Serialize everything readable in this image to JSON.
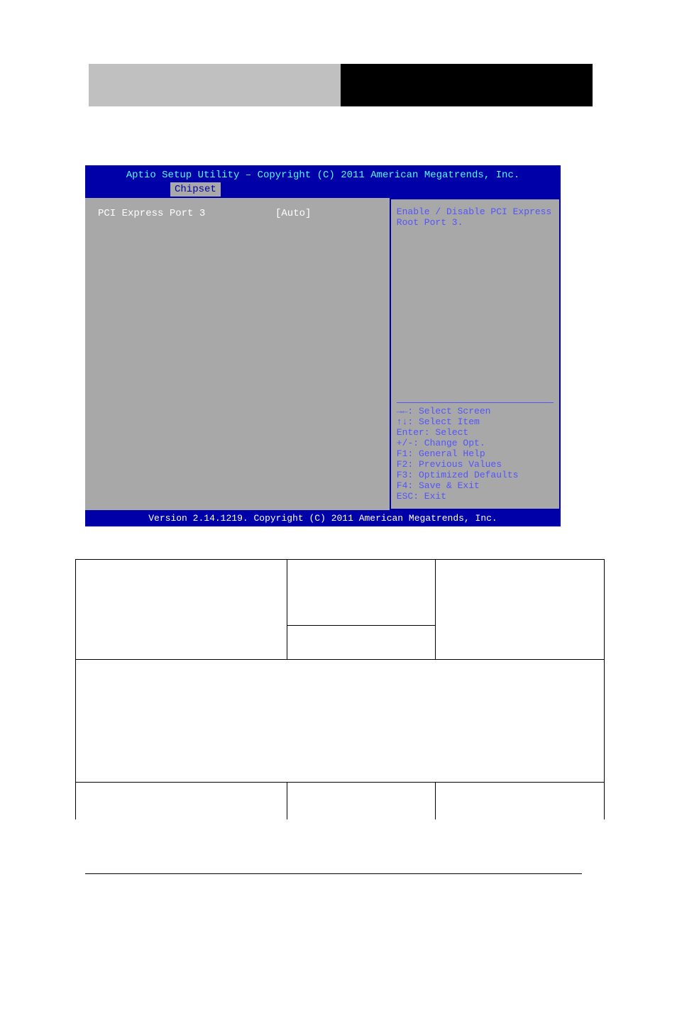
{
  "bios": {
    "title": "Aptio Setup Utility – Copyright (C) 2011 American Megatrends, Inc.",
    "tab": "Chipset",
    "item_label": "PCI Express Port 3",
    "item_value": "[Auto]",
    "help_text": "Enable / Disable PCI Express Root Port 3.",
    "keys": {
      "k1": "→←: Select Screen",
      "k2": "↑↓: Select Item",
      "k3": "Enter: Select",
      "k4": "+/-: Change Opt.",
      "k5": "F1: General Help",
      "k6": "F2: Previous Values",
      "k7": "F3: Optimized Defaults",
      "k8": "F4: Save & Exit",
      "k9": "ESC: Exit"
    },
    "footer": "Version 2.14.1219. Copyright (C) 2011 American Megatrends, Inc."
  },
  "table": {
    "r1c1": "",
    "r1c2": "",
    "r1c3": "",
    "r2c2": "",
    "r3": "",
    "r4c1": "",
    "r4c2": "",
    "r4c3": ""
  }
}
